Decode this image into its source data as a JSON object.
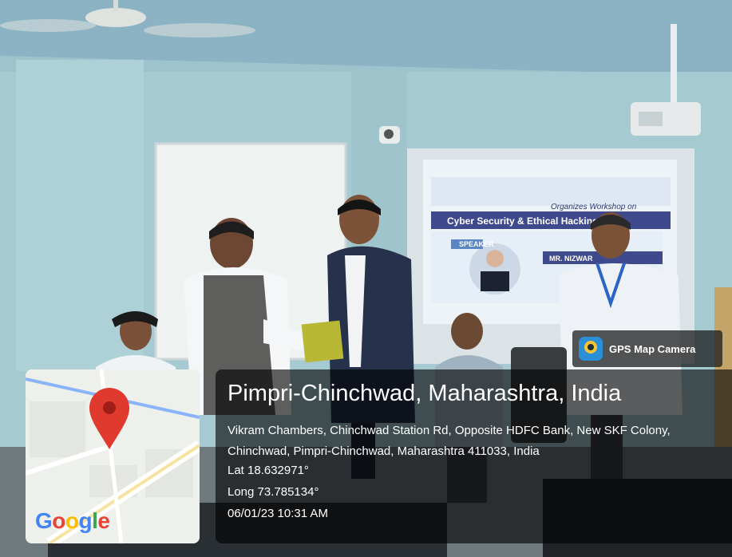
{
  "overlay": {
    "app_label": "GPS Map Camera",
    "place": "Pimpri-Chinchwad, Maharashtra, India",
    "address": "Vikram Chambers, Chinchwad Station Rd, Opposite HDFC Bank, New SKF Colony, Chinchwad, Pimpri-Chinchwad, Maharashtra 411033, India",
    "lat": "Lat 18.632971°",
    "long": "Long 73.785134°",
    "datetime": "06/01/23 10:31 AM",
    "map_brand": "Google"
  },
  "screen_slide": {
    "line1": "Organizes Workshop on",
    "line2": "Cyber Security & Ethical Hacking",
    "line3": "SPEAKER",
    "line4": "MR. NIZWAR"
  },
  "colors": {
    "pin": "#e0392e",
    "wall": "#a9ccd3",
    "ceiling": "#8fb7c7",
    "google_blue": "#4285f4",
    "google_red": "#ea4335",
    "google_yellow": "#fbbc05",
    "google_green": "#34a853"
  }
}
